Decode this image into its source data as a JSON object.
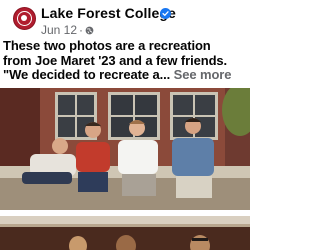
{
  "post": {
    "page_name": "Lake Forest College",
    "verified": true,
    "date": "Jun 12",
    "separator": "·",
    "audience_icon": "globe-icon",
    "text_lines": [
      "These two photos are a recreation",
      "from Joe Maret '23 and a few friends.",
      "\"We decided to recreate a..."
    ],
    "see_more": "See more"
  },
  "photos": [
    {
      "name": "recreation-photo"
    },
    {
      "name": "original-photo"
    }
  ],
  "colors": {
    "brand_red": "#b01c2e",
    "verified_blue": "#1877f2",
    "secondary_text": "#65676b"
  }
}
